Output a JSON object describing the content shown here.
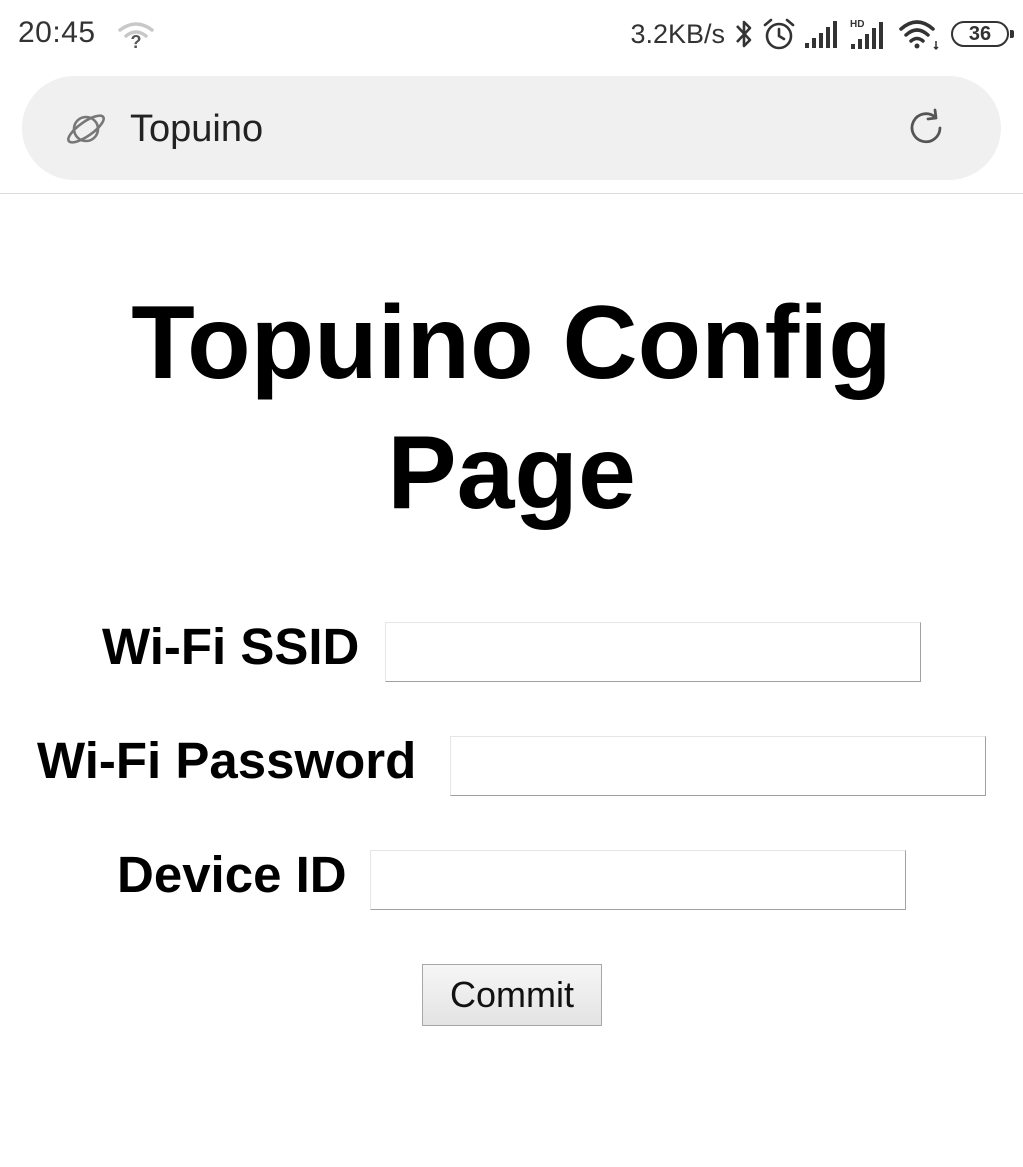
{
  "status_bar": {
    "time": "20:45",
    "net_speed": "3.2KB/s",
    "battery_level": "36",
    "icons": [
      "wifi-unknown-icon",
      "bluetooth-icon",
      "alarm-icon",
      "signal-icon",
      "hd-signal-icon",
      "wifi-icon",
      "battery-icon"
    ]
  },
  "address_bar": {
    "site_icon": "planet-icon",
    "text": "Topuino",
    "reload_icon": "reload-icon"
  },
  "page": {
    "title": "Topuino Config Page",
    "form": {
      "fields": [
        {
          "label": "Wi-Fi SSID",
          "value": ""
        },
        {
          "label": "Wi-Fi Password",
          "value": ""
        },
        {
          "label": "Device ID",
          "value": ""
        }
      ],
      "submit_label": "Commit"
    }
  }
}
